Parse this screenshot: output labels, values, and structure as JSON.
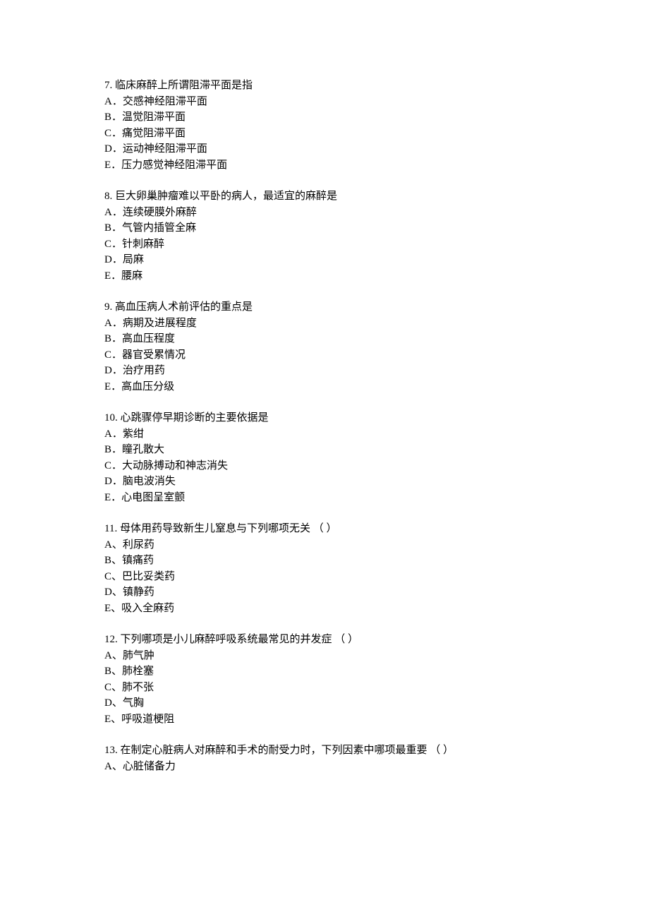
{
  "questions": [
    {
      "number": "7.",
      "stem": "临床麻醉上所谓阻滞平面是指",
      "options": [
        "A．交感神经阻滞平面",
        "B．温觉阻滞平面",
        "C．痛觉阻滞平面",
        "D．运动神经阻滞平面",
        "E．压力感觉神经阻滞平面"
      ]
    },
    {
      "number": "8.",
      "stem": "巨大卵巢肿瘤难以平卧的病人，最适宜的麻醉是",
      "options": [
        "A．连续硬膜外麻醉",
        "B．气管内插管全麻",
        "C．针刺麻醉",
        "D．局麻",
        "E．腰麻"
      ]
    },
    {
      "number": "9.",
      "stem": "高血压病人术前评估的重点是",
      "options": [
        "A．病期及进展程度",
        "B．高血压程度",
        "C．器官受累情况",
        "D．治疗用药",
        "E．高血压分级"
      ]
    },
    {
      "number": "10.",
      "stem": "心跳骤停早期诊断的主要依据是",
      "options": [
        "A．紫绀",
        "B．瞳孔散大",
        "C．大动脉搏动和神志消失",
        "D．脑电波消失",
        "E．心电图呈室颤"
      ]
    },
    {
      "number": "11.",
      "stem": "母体用药导致新生儿窒息与下列哪项无关 （  ）",
      "options": [
        "A、利尿药",
        "B、镇痛药",
        "C、巴比妥类药",
        "D、镇静药",
        "E、吸入全麻药"
      ]
    },
    {
      "number": "12.",
      "stem": "下列哪项是小儿麻醉呼吸系统最常见的并发症 （  ）",
      "options": [
        "A、肺气肿",
        "B、肺栓塞",
        "C、肺不张",
        "D、气胸",
        "E、呼吸道梗阻"
      ]
    },
    {
      "number": "13.",
      "stem": "在制定心脏病人对麻醉和手术的耐受力时，下列因素中哪项最重要 （  ）",
      "options": [
        "A、心脏储备力"
      ]
    }
  ]
}
